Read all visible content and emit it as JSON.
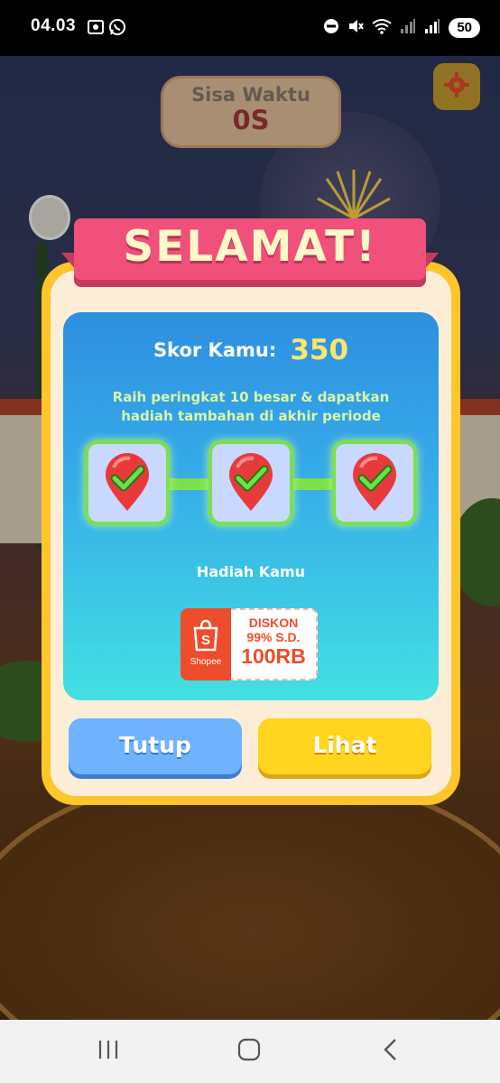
{
  "status_bar": {
    "time": "04.03",
    "battery": "50",
    "icons": [
      "screenshot-icon",
      "whatsapp-icon",
      "dnd-icon",
      "mute-icon",
      "wifi-icon",
      "signal-icon",
      "signal-icon"
    ]
  },
  "game": {
    "timer_label": "Sisa Waktu",
    "timer_value": "0S",
    "settings_icon": "gear-icon"
  },
  "modal": {
    "title": "SELAMAT!",
    "score_label": "Skor Kamu:",
    "score_value": "350",
    "instruction_line1": "Raih peringkat 10 besar & dapatkan",
    "instruction_line2": "hadiah tambahan di akhir periode",
    "steps_completed": 3,
    "steps_total": 3,
    "reward_label": "Hadiah Kamu",
    "voucher": {
      "brand": "Shopee",
      "line1": "DISKON",
      "line2": "99% S.D.",
      "line3": "100RB",
      "brand_color": "#ee4d2d"
    },
    "close_button": "Tutup",
    "view_button": "Lihat"
  },
  "nav_bar": {
    "icons": [
      "recents-icon",
      "home-icon",
      "back-icon"
    ]
  },
  "colors": {
    "accent_yellow": "#ffc52b",
    "ribbon_pink": "#f0507a",
    "step_green": "#7ce04a",
    "close_blue": "#6fb3ff",
    "view_yellow": "#ffd51f"
  }
}
